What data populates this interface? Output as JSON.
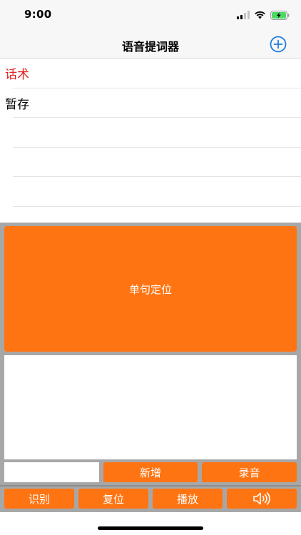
{
  "status_bar": {
    "time": "9:00"
  },
  "nav": {
    "title": "语音提词器"
  },
  "list": {
    "items": [
      {
        "label": "话术"
      },
      {
        "label": "暂存"
      },
      {
        "label": ""
      },
      {
        "label": ""
      },
      {
        "label": ""
      }
    ]
  },
  "controls": {
    "locate_label": "单句定位",
    "add_label": "新增",
    "record_label": "录音",
    "recognize_label": "识别",
    "reset_label": "复位",
    "play_label": "播放"
  },
  "colors": {
    "accent_orange": "#ff7412",
    "active_red": "#e02020",
    "panel_gray": "#a7a7a7",
    "nav_blue": "#1f7ce0"
  },
  "icons": {
    "add": "plus-circle-icon",
    "speaker": "speaker-icon"
  }
}
